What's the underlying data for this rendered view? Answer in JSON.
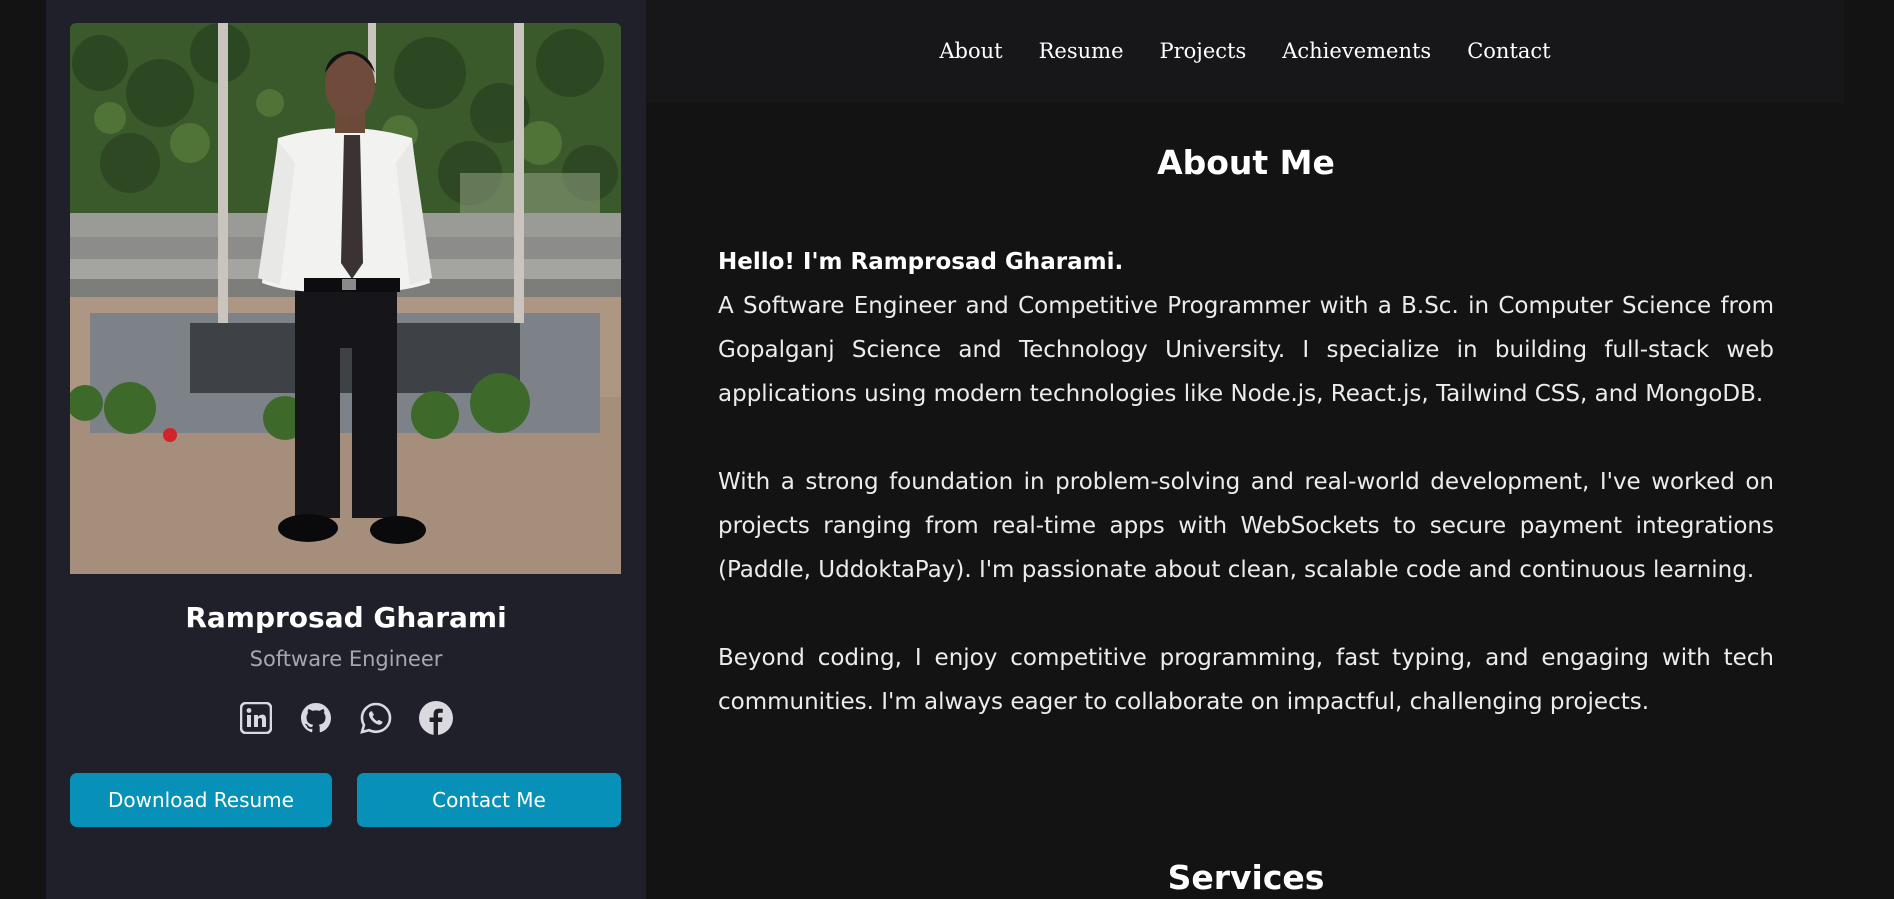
{
  "nav": {
    "items": [
      "About",
      "Resume",
      "Projects",
      "Achievements",
      "Contact"
    ]
  },
  "profile": {
    "name": "Ramprosad Gharami",
    "role": "Software Engineer",
    "socials": [
      "linkedin-icon",
      "github-icon",
      "whatsapp-icon",
      "facebook-icon"
    ],
    "download_resume_label": "Download Resume",
    "contact_label": "Contact Me"
  },
  "about": {
    "title": "About Me",
    "greeting": "Hello! I'm Ramprosad Gharami.",
    "p1": "A Software Engineer and Competitive Programmer with a B.Sc. in Computer Science from Gopalganj Science and Technology University. I specialize in building full-stack web applications using modern technologies like Node.js, React.js, Tailwind CSS, and MongoDB.",
    "p2": "With a strong foundation in problem-solving and real-world development, I've worked on projects ranging from real-time apps with WebSockets to secure payment integrations (Paddle, UddoktaPay). I'm passionate about clean, scalable code and continuous learning.",
    "p3": "Beyond coding, I enjoy competitive programming, fast typing, and engaging with tech communities. I'm always eager to collaborate on impactful, challenging projects."
  },
  "services": {
    "title": "Services"
  },
  "colors": {
    "background": "#131314",
    "sidebar": "#1f2029",
    "accent_button": "#0891b8",
    "muted_text": "#a6a8b0"
  }
}
